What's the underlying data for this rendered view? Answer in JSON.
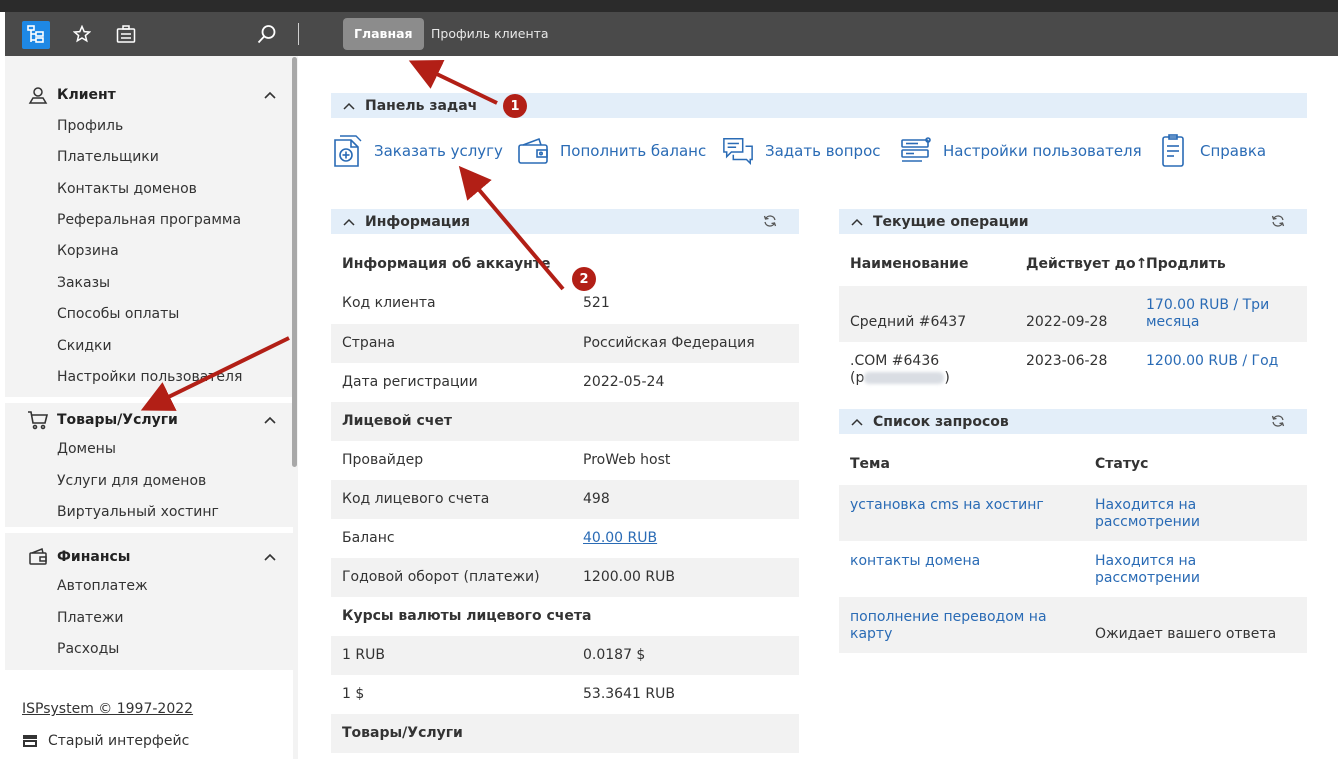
{
  "topbar": {
    "logo_icon": "site-tree-icon",
    "favorites_icon": "star-icon",
    "clipboard_icon": "clipboard-icon",
    "search_icon": "search-icon",
    "tabs": [
      {
        "label": "Главная",
        "active": true
      },
      {
        "label": "Профиль клиента",
        "active": false
      }
    ]
  },
  "sidebar": {
    "sections": [
      {
        "title": "Клиент",
        "icon": "client-icon",
        "items": [
          "Профиль",
          "Плательщики",
          "Контакты доменов",
          "Реферальная программа",
          "Корзина",
          "Заказы",
          "Способы оплаты",
          "Скидки",
          "Настройки пользователя"
        ]
      },
      {
        "title": "Товары/Услуги",
        "icon": "cart-icon",
        "items": [
          "Домены",
          "Услуги для доменов",
          "Виртуальный хостинг"
        ]
      },
      {
        "title": "Финансы",
        "icon": "wallet-icon",
        "items": [
          "Автоплатеж",
          "Платежи",
          "Расходы"
        ]
      }
    ],
    "footer": {
      "copyright": "ISPsystem © 1997-2022",
      "old_ui": "Старый интерфейс"
    }
  },
  "tasks": {
    "title": "Панель задач",
    "actions": [
      {
        "label": "Заказать услугу",
        "icon": "order-service-icon"
      },
      {
        "label": "Пополнить баланс",
        "icon": "wallet-icon"
      },
      {
        "label": "Задать вопрос",
        "icon": "chat-icon"
      },
      {
        "label": "Настройки пользователя",
        "icon": "user-settings-icon"
      },
      {
        "label": "Справка",
        "icon": "help-doc-icon"
      }
    ]
  },
  "info": {
    "title": "Информация",
    "account_header": "Информация об аккаунте",
    "client_code_label": "Код клиента",
    "client_code": "521",
    "country_label": "Страна",
    "country": "Российская Федерация",
    "reg_date_label": "Дата регистрации",
    "reg_date": "2022-05-24",
    "personal_account_header": "Лицевой счет",
    "provider_label": "Провайдер",
    "provider": "ProWeb host",
    "account_code_label": "Код лицевого счета",
    "account_code": "498",
    "balance_label": "Баланс",
    "balance": "40.00 RUB",
    "turnover_label": "Годовой оборот (платежи)",
    "turnover": "1200.00 RUB",
    "rates_header": "Курсы валюты лицевого счета",
    "rate1_label": "1 RUB",
    "rate1": "0.0187 $",
    "rate2_label": "1 $",
    "rate2": "53.3641 RUB",
    "goods_header": "Товары/Услуги"
  },
  "operations": {
    "title": "Текущие операции",
    "columns": {
      "name": "Наименование",
      "valid_until": "Действует до",
      "sort_arrow": "↑",
      "renew": "Продлить"
    },
    "rows": [
      {
        "name": "Средний #6437",
        "valid_until": "2022-09-28",
        "renew_line1": "170.00 RUB / Три",
        "renew_line2": "месяца"
      },
      {
        "name_line1": ".COM #6436",
        "name_line2": "(p",
        "name_line2_end": ")",
        "valid_until": "2023-06-28",
        "renew": "1200.00 RUB / Год"
      }
    ]
  },
  "requests": {
    "title": "Список запросов",
    "columns": {
      "topic": "Тема",
      "status": "Статус"
    },
    "rows": [
      {
        "topic": "установка cms на хостинг",
        "status_line1": "Находится на",
        "status_line2": "рассмотрении"
      },
      {
        "topic": "контакты домена",
        "status_line1": "Находится на",
        "status_line2": "рассмотрении"
      },
      {
        "topic_line1": "пополнение переводом на",
        "topic_line2": "карту",
        "status": "Ожидает вашего ответа"
      }
    ]
  },
  "annotations": {
    "badge1": "1",
    "badge2": "2"
  },
  "colors": {
    "accent": "#1e88e5",
    "link": "#2a6bb5",
    "panel_header": "#e3eef9",
    "arrow": "#b21f16",
    "topbar": "#4a4a4a"
  }
}
